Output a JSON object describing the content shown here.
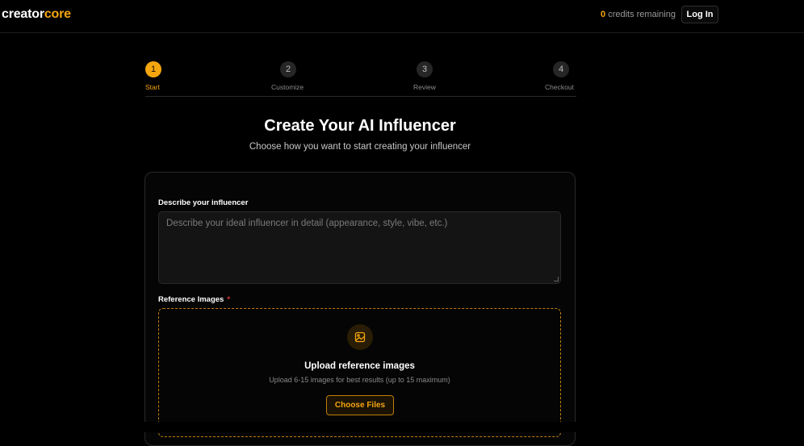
{
  "brand": {
    "part1": "creator",
    "part2": "core",
    "accent": "#f5a60f"
  },
  "header": {
    "credits_count": "0",
    "credits_text": "credits remaining",
    "login_label": "Log In"
  },
  "stepper": {
    "steps": [
      {
        "number": "1",
        "label": "Start"
      },
      {
        "number": "2",
        "label": "Customize"
      },
      {
        "number": "3",
        "label": "Review"
      },
      {
        "number": "4",
        "label": "Checkout"
      }
    ]
  },
  "main": {
    "title": "Create Your AI Influencer",
    "subtitle": "Choose how you want to start creating your influencer"
  },
  "form": {
    "describe_label": "Describe your influencer",
    "describe_placeholder": "Describe your ideal influencer in detail (appearance, style, vibe, etc.)",
    "describe_value": "",
    "reference_label": "Reference Images",
    "required_marker": "*",
    "upload": {
      "icon": "image-icon",
      "title": "Upload reference images",
      "subtitle": "Upload 6-15 images for best results (up to 15 maximum)",
      "button_label": "Choose Files"
    }
  }
}
